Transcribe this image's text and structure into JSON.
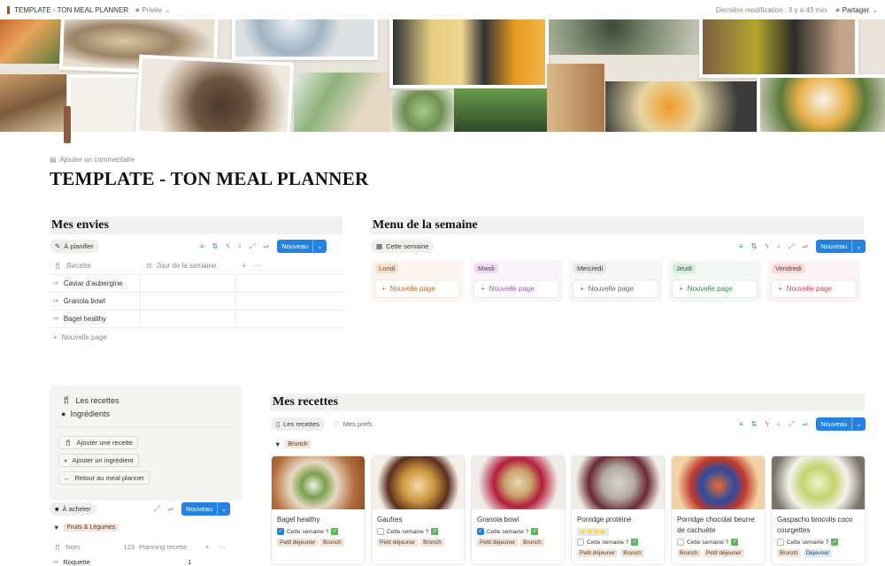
{
  "topbar": {
    "title": "TEMPLATE - TON MEAL PLANNER",
    "privacy": "Privée",
    "last_edit": "Dernière modification : Il y a 43 min",
    "share": "Partager"
  },
  "header": {
    "add_comment": "Ajouter un commentaire",
    "title": "TEMPLATE - TON MEAL PLANNER"
  },
  "envies": {
    "title": "Mes envies",
    "view": "À planifier",
    "new": "Nouveau",
    "col_recette": "Recette",
    "col_jour": "Jour de la semaine",
    "rows": [
      "Caviar d'aubergine",
      "Granola bowl",
      "Bagel healthy"
    ],
    "new_page": "Nouvelle page"
  },
  "menu": {
    "title": "Menu de la semaine",
    "view": "Cette semaine",
    "new": "Nouveau",
    "columns": [
      {
        "label": "Lundi",
        "bg": "#fdf6f0",
        "lab_bg": "#f8dfcb",
        "lab_fg": "#7a4522",
        "fg": "#c26a2a",
        "new_page": "Nouvelle page"
      },
      {
        "label": "Mardi",
        "bg": "#faf4fb",
        "lab_bg": "#ecdaf0",
        "lab_fg": "#5e3b6e",
        "fg": "#9a5bb4",
        "new_page": "Nouvelle page"
      },
      {
        "label": "Mercredi",
        "bg": "#f6f6f5",
        "lab_bg": "#e6e5e3",
        "lab_fg": "#37352f",
        "fg": "#6b6964",
        "new_page": "Nouvelle page"
      },
      {
        "label": "Jeudi",
        "bg": "#f2f8f4",
        "lab_bg": "#d6ecdc",
        "lab_fg": "#2c5a3c",
        "fg": "#3d8a57",
        "new_page": "Nouvelle page"
      },
      {
        "label": "Vendredi",
        "bg": "#fcf3f4",
        "lab_bg": "#f6dcdf",
        "lab_fg": "#7a2f3a",
        "fg": "#c64a5d",
        "new_page": "Nouvelle page"
      }
    ]
  },
  "nav": {
    "recettes": "Les recettes",
    "ingredients": "Ingrédients",
    "add_recette": "Ajouter une recette",
    "add_ingredient": "Ajouter un ingrédient",
    "back": "Retour au meal planner"
  },
  "acheter": {
    "view": "À acheter",
    "new": "Nouveau",
    "group": "Fruits & Légumes",
    "col_nom": "Nom",
    "col_planning": "Planning recette",
    "row1": "Roquette",
    "row1_val": "1"
  },
  "recettes": {
    "title": "Mes recettes",
    "view1": "Les recettes",
    "view2": "Mes prefs",
    "new": "Nouveau",
    "group": "Brunch",
    "check_label": "Cette semaine ?",
    "cards": [
      {
        "name": "Bagel healthy",
        "checked": true,
        "tags": [
          {
            "t": "Petit déjeuner",
            "c": ""
          },
          {
            "t": "Brunch",
            "c": ""
          }
        ]
      },
      {
        "name": "Gaufres",
        "checked": false,
        "tags": [
          {
            "t": "Petit déjeuner",
            "c": ""
          },
          {
            "t": "Brunch",
            "c": ""
          }
        ]
      },
      {
        "name": "Granola bowl",
        "checked": true,
        "tags": [
          {
            "t": "Petit déjeuner",
            "c": ""
          },
          {
            "t": "Brunch",
            "c": ""
          }
        ]
      },
      {
        "name": "Porridge protéiné",
        "checked": false,
        "stars": "⭐⭐⭐⭐",
        "tags": [
          {
            "t": "Petit déjeuner",
            "c": ""
          },
          {
            "t": "Brunch",
            "c": ""
          }
        ]
      },
      {
        "name": "Porridge chocolat beurre de cachuète",
        "checked": false,
        "tags": [
          {
            "t": "Brunch",
            "c": ""
          },
          {
            "t": "Petit déjeuner",
            "c": ""
          }
        ]
      },
      {
        "name": "Gaspacho brocolis coco courgettes",
        "checked": false,
        "tags": [
          {
            "t": "Brunch",
            "c": ""
          },
          {
            "t": "Déjeuner",
            "c": "blue"
          }
        ]
      }
    ]
  }
}
